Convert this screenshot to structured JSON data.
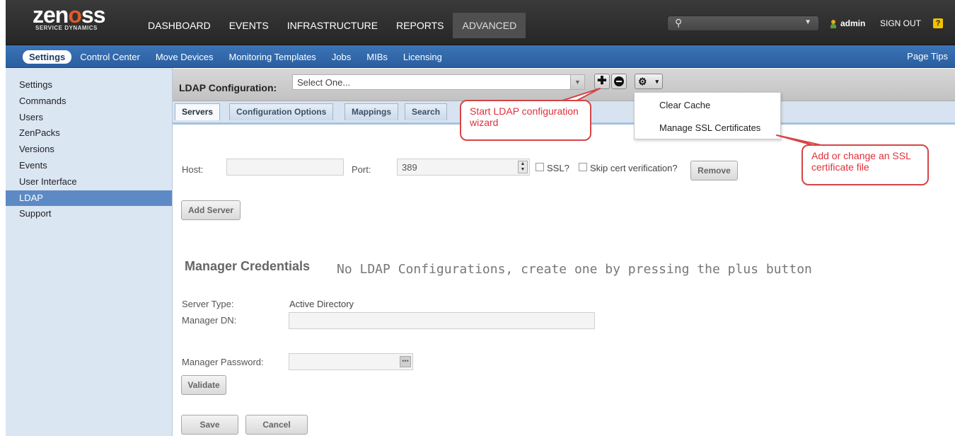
{
  "topnav": {
    "logo_text": "zenoss",
    "logo_subtitle": "SERVICE DYNAMICS",
    "menu": [
      "DASHBOARD",
      "EVENTS",
      "INFRASTRUCTURE",
      "REPORTS",
      "ADVANCED"
    ],
    "active_menu": "ADVANCED",
    "search_icon": "search-icon",
    "user": "admin",
    "sign_out": "SIGN OUT",
    "help_glyph": "?"
  },
  "subnav": {
    "items": [
      "Settings",
      "Control Center",
      "Move Devices",
      "Monitoring Templates",
      "Jobs",
      "MIBs",
      "Licensing"
    ],
    "active": "Settings",
    "page_tips": "Page Tips"
  },
  "sidebar": {
    "items": [
      "Settings",
      "Commands",
      "Users",
      "ZenPacks",
      "Versions",
      "Events",
      "User Interface",
      "LDAP",
      "Support"
    ],
    "active": "LDAP"
  },
  "ldap": {
    "title": "LDAP Configuration:",
    "select_placeholder": "Select One...",
    "tabs": [
      "Servers",
      "Configuration Options",
      "Mappings",
      "Search"
    ],
    "active_tab": "Servers"
  },
  "gear_menu": {
    "items": [
      "Clear Cache",
      "Manage SSL Certificates"
    ]
  },
  "servers": {
    "host_label": "Host:",
    "host_value": "",
    "port_label": "Port:",
    "port_value": "389",
    "ssl_label": "SSL?",
    "skip_cert_label": "Skip cert verification?",
    "remove_button": "Remove",
    "add_server_button": "Add Server"
  },
  "credentials": {
    "title": "Manager Credentials",
    "empty_message": "No LDAP Configurations, create one by pressing the plus button",
    "server_type_label": "Server Type:",
    "server_type_value": "Active Directory",
    "manager_dn_label": "Manager DN:",
    "manager_dn_value": "",
    "manager_password_label": "Manager Password:",
    "validate_button": "Validate",
    "save_button": "Save",
    "cancel_button": "Cancel"
  },
  "callouts": {
    "wizard": "Start LDAP configuration wizard",
    "ssl": "Add or change an SSL certificate file"
  },
  "colors": {
    "topnav_bg": "#2e2e2e",
    "subnav_bg": "#3269ab",
    "sidebar_bg": "#dbe6f3",
    "sidebar_active": "#5d8ac5",
    "callout_red": "#e0303a"
  }
}
